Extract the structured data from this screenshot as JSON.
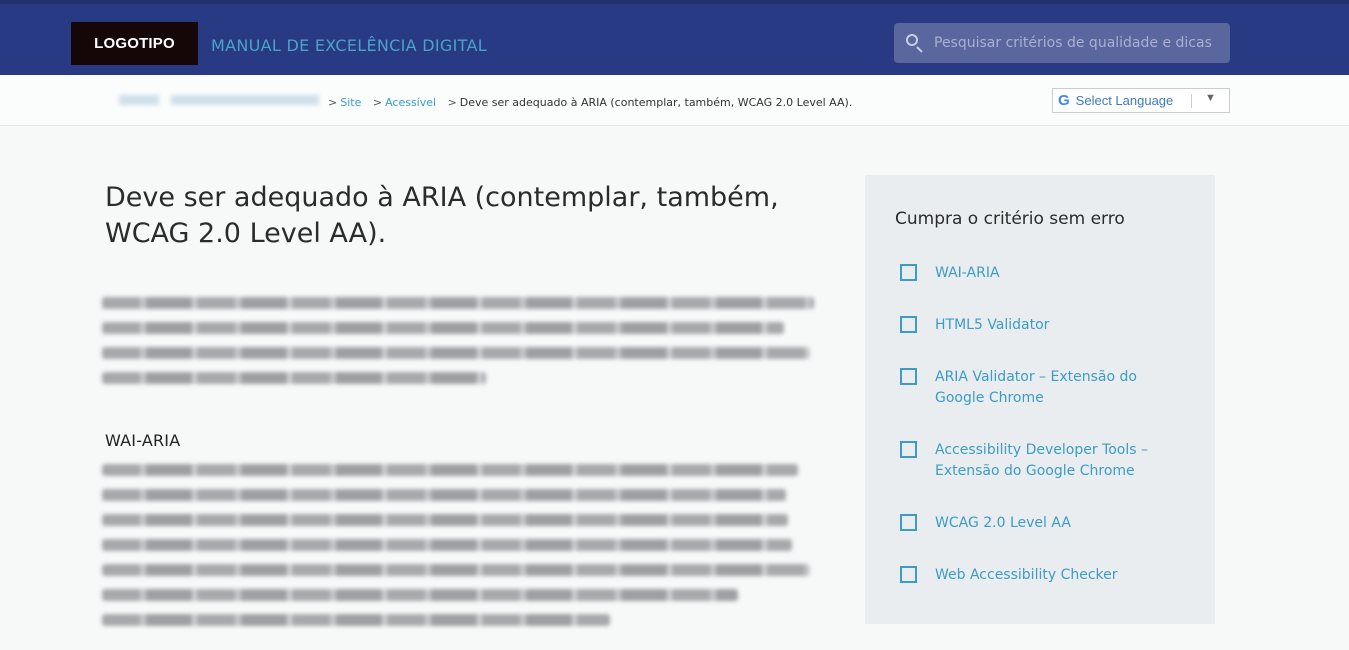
{
  "header": {
    "logo": "LOGOTIPO",
    "site_title": "MANUAL DE EXCELÊNCIA DIGITAL",
    "search_placeholder": "Pesquisar critérios de qualidade e dicas"
  },
  "breadcrumb": {
    "items": [
      "Site",
      "Acessível"
    ],
    "current": "Deve ser adequado à ARIA (contemplar, também, WCAG 2.0 Level AA)."
  },
  "language": {
    "label": "Select Language",
    "g_glyph": "G"
  },
  "main": {
    "title": "Deve ser adequado à ARIA (contemplar, também, WCAG 2.0 Level AA).",
    "section_heading": "WAI-ARIA"
  },
  "sidebar": {
    "title": "Cumpra o critério sem erro",
    "items": [
      "WAI-ARIA",
      "HTML5 Validator",
      "ARIA Validator – Extensão do Google Chrome",
      "Accessibility Developer Tools – Extensão do Google Chrome",
      "WCAG 2.0 Level AA",
      "Web Accessibility Checker"
    ]
  },
  "colors": {
    "header_bg": "#293a84",
    "accent": "#3c9cc6",
    "sidebar_bg": "#e9edf0"
  }
}
